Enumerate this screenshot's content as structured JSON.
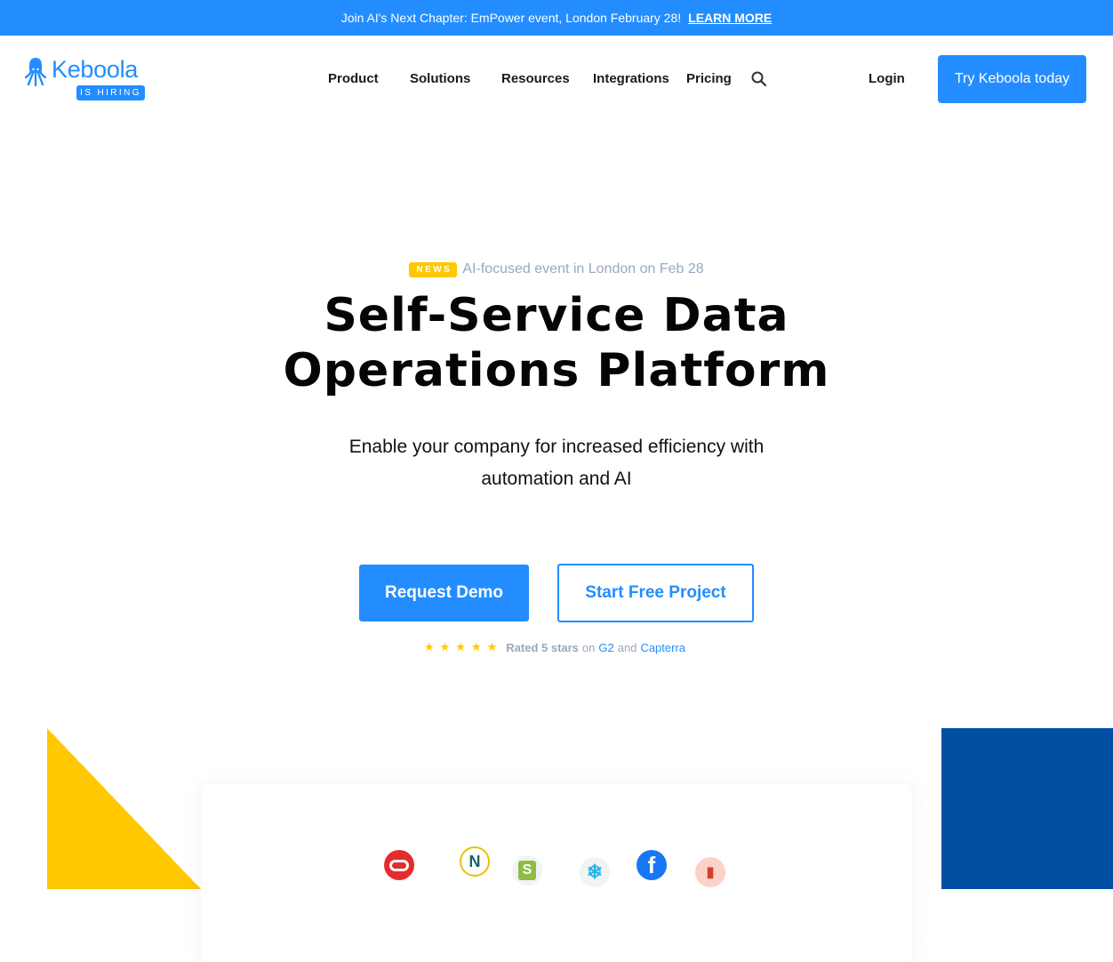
{
  "banner": {
    "text": "Join AI's Next Chapter: EmPower event, London February 28!",
    "link": "LEARN MORE"
  },
  "header": {
    "logo_text": "Keboola",
    "hiring_badge": "IS HIRING",
    "nav": [
      {
        "label": "Product"
      },
      {
        "label": "Solutions"
      },
      {
        "label": "Resources"
      },
      {
        "label": "Integrations"
      },
      {
        "label": "Pricing"
      }
    ],
    "login": "Login",
    "cta": "Try Keboola today"
  },
  "hero": {
    "news_badge": "NEWS",
    "news_text": "AI-focused event in London on Feb 28",
    "title_line1": "Self-Service Data",
    "title_line2": "Operations Platform",
    "subtitle_line1": "Enable your company for increased efficiency with",
    "subtitle_line2": "automation and AI",
    "primary_button": "Request Demo",
    "secondary_button": "Start Free Project",
    "rating": {
      "stars": 5,
      "stars_glyphs": "★★★★★",
      "rated": "Rated 5 stars",
      "on": "on",
      "g2": "G2",
      "and": "and",
      "capterra": "Capterra"
    }
  },
  "integrations": [
    {
      "name": "oracle-icon",
      "glyph": ""
    },
    {
      "name": "n-icon",
      "glyph": "N"
    },
    {
      "name": "shopify-icon",
      "glyph": "S"
    },
    {
      "name": "snowflake-icon",
      "glyph": "❄"
    },
    {
      "name": "facebook-icon",
      "glyph": "f"
    },
    {
      "name": "aws-s3-icon",
      "glyph": "▮"
    }
  ],
  "colors": {
    "accent": "#238dff",
    "yellow": "#ffc800",
    "dark_blue": "#004fa3",
    "muted_text": "#98a8bc"
  }
}
